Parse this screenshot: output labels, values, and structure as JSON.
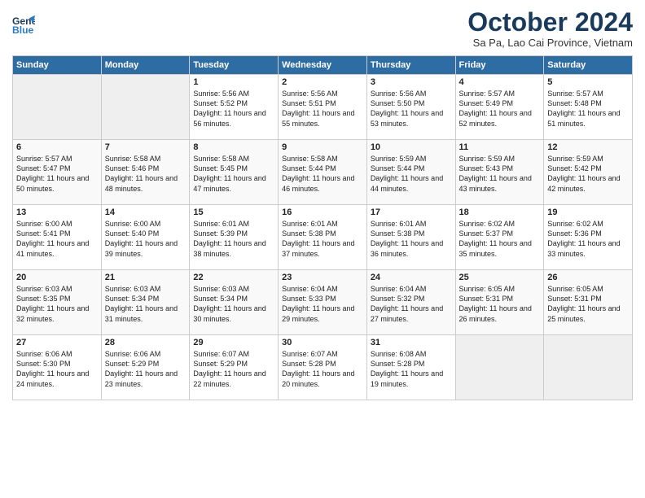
{
  "header": {
    "logo_line1": "General",
    "logo_line2": "Blue",
    "month": "October 2024",
    "location": "Sa Pa, Lao Cai Province, Vietnam"
  },
  "weekdays": [
    "Sunday",
    "Monday",
    "Tuesday",
    "Wednesday",
    "Thursday",
    "Friday",
    "Saturday"
  ],
  "weeks": [
    [
      {
        "day": "",
        "sunrise": "",
        "sunset": "",
        "daylight": ""
      },
      {
        "day": "",
        "sunrise": "",
        "sunset": "",
        "daylight": ""
      },
      {
        "day": "1",
        "sunrise": "Sunrise: 5:56 AM",
        "sunset": "Sunset: 5:52 PM",
        "daylight": "Daylight: 11 hours and 56 minutes."
      },
      {
        "day": "2",
        "sunrise": "Sunrise: 5:56 AM",
        "sunset": "Sunset: 5:51 PM",
        "daylight": "Daylight: 11 hours and 55 minutes."
      },
      {
        "day": "3",
        "sunrise": "Sunrise: 5:56 AM",
        "sunset": "Sunset: 5:50 PM",
        "daylight": "Daylight: 11 hours and 53 minutes."
      },
      {
        "day": "4",
        "sunrise": "Sunrise: 5:57 AM",
        "sunset": "Sunset: 5:49 PM",
        "daylight": "Daylight: 11 hours and 52 minutes."
      },
      {
        "day": "5",
        "sunrise": "Sunrise: 5:57 AM",
        "sunset": "Sunset: 5:48 PM",
        "daylight": "Daylight: 11 hours and 51 minutes."
      }
    ],
    [
      {
        "day": "6",
        "sunrise": "Sunrise: 5:57 AM",
        "sunset": "Sunset: 5:47 PM",
        "daylight": "Daylight: 11 hours and 50 minutes."
      },
      {
        "day": "7",
        "sunrise": "Sunrise: 5:58 AM",
        "sunset": "Sunset: 5:46 PM",
        "daylight": "Daylight: 11 hours and 48 minutes."
      },
      {
        "day": "8",
        "sunrise": "Sunrise: 5:58 AM",
        "sunset": "Sunset: 5:45 PM",
        "daylight": "Daylight: 11 hours and 47 minutes."
      },
      {
        "day": "9",
        "sunrise": "Sunrise: 5:58 AM",
        "sunset": "Sunset: 5:44 PM",
        "daylight": "Daylight: 11 hours and 46 minutes."
      },
      {
        "day": "10",
        "sunrise": "Sunrise: 5:59 AM",
        "sunset": "Sunset: 5:44 PM",
        "daylight": "Daylight: 11 hours and 44 minutes."
      },
      {
        "day": "11",
        "sunrise": "Sunrise: 5:59 AM",
        "sunset": "Sunset: 5:43 PM",
        "daylight": "Daylight: 11 hours and 43 minutes."
      },
      {
        "day": "12",
        "sunrise": "Sunrise: 5:59 AM",
        "sunset": "Sunset: 5:42 PM",
        "daylight": "Daylight: 11 hours and 42 minutes."
      }
    ],
    [
      {
        "day": "13",
        "sunrise": "Sunrise: 6:00 AM",
        "sunset": "Sunset: 5:41 PM",
        "daylight": "Daylight: 11 hours and 41 minutes."
      },
      {
        "day": "14",
        "sunrise": "Sunrise: 6:00 AM",
        "sunset": "Sunset: 5:40 PM",
        "daylight": "Daylight: 11 hours and 39 minutes."
      },
      {
        "day": "15",
        "sunrise": "Sunrise: 6:01 AM",
        "sunset": "Sunset: 5:39 PM",
        "daylight": "Daylight: 11 hours and 38 minutes."
      },
      {
        "day": "16",
        "sunrise": "Sunrise: 6:01 AM",
        "sunset": "Sunset: 5:38 PM",
        "daylight": "Daylight: 11 hours and 37 minutes."
      },
      {
        "day": "17",
        "sunrise": "Sunrise: 6:01 AM",
        "sunset": "Sunset: 5:38 PM",
        "daylight": "Daylight: 11 hours and 36 minutes."
      },
      {
        "day": "18",
        "sunrise": "Sunrise: 6:02 AM",
        "sunset": "Sunset: 5:37 PM",
        "daylight": "Daylight: 11 hours and 35 minutes."
      },
      {
        "day": "19",
        "sunrise": "Sunrise: 6:02 AM",
        "sunset": "Sunset: 5:36 PM",
        "daylight": "Daylight: 11 hours and 33 minutes."
      }
    ],
    [
      {
        "day": "20",
        "sunrise": "Sunrise: 6:03 AM",
        "sunset": "Sunset: 5:35 PM",
        "daylight": "Daylight: 11 hours and 32 minutes."
      },
      {
        "day": "21",
        "sunrise": "Sunrise: 6:03 AM",
        "sunset": "Sunset: 5:34 PM",
        "daylight": "Daylight: 11 hours and 31 minutes."
      },
      {
        "day": "22",
        "sunrise": "Sunrise: 6:03 AM",
        "sunset": "Sunset: 5:34 PM",
        "daylight": "Daylight: 11 hours and 30 minutes."
      },
      {
        "day": "23",
        "sunrise": "Sunrise: 6:04 AM",
        "sunset": "Sunset: 5:33 PM",
        "daylight": "Daylight: 11 hours and 29 minutes."
      },
      {
        "day": "24",
        "sunrise": "Sunrise: 6:04 AM",
        "sunset": "Sunset: 5:32 PM",
        "daylight": "Daylight: 11 hours and 27 minutes."
      },
      {
        "day": "25",
        "sunrise": "Sunrise: 6:05 AM",
        "sunset": "Sunset: 5:31 PM",
        "daylight": "Daylight: 11 hours and 26 minutes."
      },
      {
        "day": "26",
        "sunrise": "Sunrise: 6:05 AM",
        "sunset": "Sunset: 5:31 PM",
        "daylight": "Daylight: 11 hours and 25 minutes."
      }
    ],
    [
      {
        "day": "27",
        "sunrise": "Sunrise: 6:06 AM",
        "sunset": "Sunset: 5:30 PM",
        "daylight": "Daylight: 11 hours and 24 minutes."
      },
      {
        "day": "28",
        "sunrise": "Sunrise: 6:06 AM",
        "sunset": "Sunset: 5:29 PM",
        "daylight": "Daylight: 11 hours and 23 minutes."
      },
      {
        "day": "29",
        "sunrise": "Sunrise: 6:07 AM",
        "sunset": "Sunset: 5:29 PM",
        "daylight": "Daylight: 11 hours and 22 minutes."
      },
      {
        "day": "30",
        "sunrise": "Sunrise: 6:07 AM",
        "sunset": "Sunset: 5:28 PM",
        "daylight": "Daylight: 11 hours and 20 minutes."
      },
      {
        "day": "31",
        "sunrise": "Sunrise: 6:08 AM",
        "sunset": "Sunset: 5:28 PM",
        "daylight": "Daylight: 11 hours and 19 minutes."
      },
      {
        "day": "",
        "sunrise": "",
        "sunset": "",
        "daylight": ""
      },
      {
        "day": "",
        "sunrise": "",
        "sunset": "",
        "daylight": ""
      }
    ]
  ]
}
